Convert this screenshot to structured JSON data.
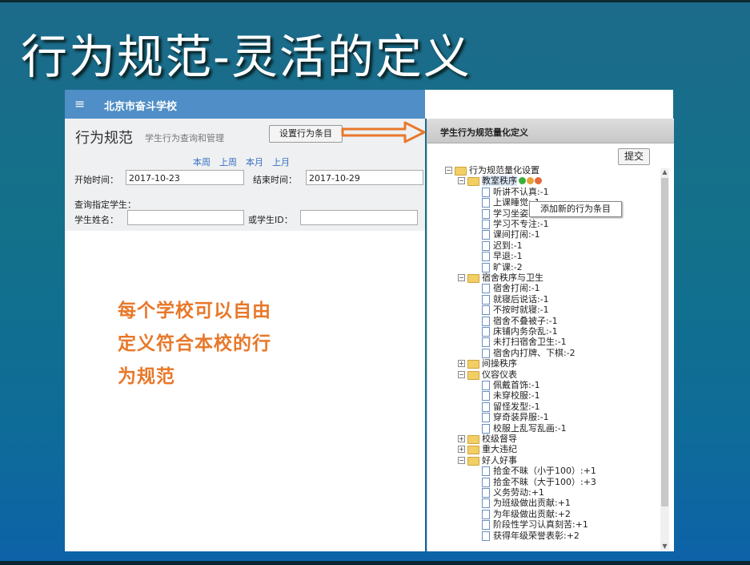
{
  "slide": {
    "title": "行为规范-灵活的定义"
  },
  "app": {
    "menu_icon": "≡",
    "school_name": "北京市奋斗学校"
  },
  "form": {
    "page_title": "行为规范",
    "page_subtitle": "学生行为查询和管理",
    "set_button": "设置行为条目",
    "quick_links": [
      "本周",
      "上周",
      "本月",
      "上月"
    ],
    "start_label": "开始时间：",
    "start_value": "2017-10-23",
    "end_label": "结束时间：",
    "end_value": "2017-10-29",
    "query_label": "查询指定学生：",
    "name_label": "学生姓名：",
    "name_value": "",
    "id_label": "或学生ID：",
    "id_value": ""
  },
  "promo": {
    "line1": "每个学校可以自由",
    "line2": "定义符合本校的行",
    "line3": "为规范"
  },
  "panel": {
    "title": "学生行为规范量化定义",
    "submit": "提交",
    "tooltip": "添加新的行为条目"
  },
  "tree": {
    "root": "行为规范量化设置",
    "groups": [
      {
        "label": "教室秩序",
        "expanded": true,
        "items": [
          "听讲不认真:-1",
          "上课睡觉:-1",
          "学习坐姿不端:-1",
          "学习不专注:-1",
          "课间打闹:-1",
          "迟到:-1",
          "早退:-1",
          "旷课:-2"
        ]
      },
      {
        "label": "宿舍秩序与卫生",
        "expanded": true,
        "items": [
          "宿舍打闹:-1",
          "就寝后说话:-1",
          "不按时就寝:-1",
          "宿舍不叠被子:-1",
          "床铺内务杂乱:-1",
          "未打扫宿舍卫生:-1",
          "宿舍内打牌、下棋:-2"
        ]
      },
      {
        "label": "间操秩序",
        "expanded": false,
        "items": []
      },
      {
        "label": "仪容仪表",
        "expanded": true,
        "items": [
          "佩戴首饰:-1",
          "未穿校服:-1",
          "留怪发型:-1",
          "穿奇装异服:-1",
          "校服上乱写乱画:-1"
        ]
      },
      {
        "label": "校级督导",
        "expanded": false,
        "items": []
      },
      {
        "label": "重大违纪",
        "expanded": false,
        "items": []
      },
      {
        "label": "好人好事",
        "expanded": true,
        "items": [
          "拾金不昧（小于100）:+1",
          "拾金不昧（大于100）:+3",
          "义务劳动:+1",
          "为班级做出贡献:+1",
          "为年级做出贡献:+2",
          "阶段性学习认真刻苦:+1",
          "获得年级荣誉表彰:+2"
        ]
      }
    ]
  },
  "colors": {
    "header_blue": "#4f8ec6",
    "promo_orange": "#e8782a",
    "arrow_orange": "#e8782a"
  }
}
